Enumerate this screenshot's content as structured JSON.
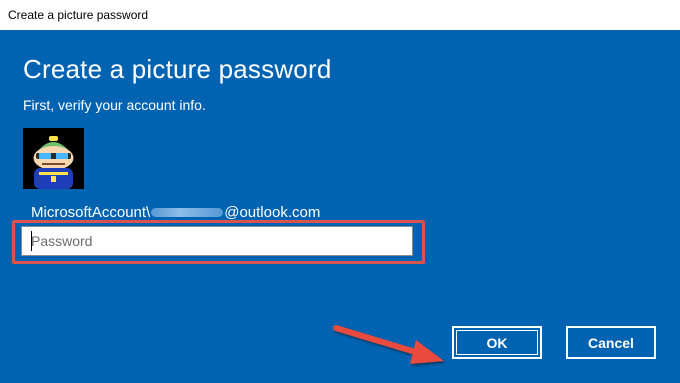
{
  "window": {
    "title": "Create a picture password"
  },
  "dialog": {
    "heading": "Create a picture password",
    "subheading": "First, verify your account info.",
    "avatar": {
      "icon": "user-avatar-icon"
    },
    "account": {
      "prefix": "MicrosoftAccount\\",
      "suffix": "@outlook.com"
    },
    "password": {
      "placeholder": "Password",
      "value": ""
    }
  },
  "buttons": {
    "ok_label": "OK",
    "cancel_label": "Cancel"
  },
  "annotation": {
    "highlight_color": "#d9534f",
    "arrow_color": "#e84c3d"
  },
  "colors": {
    "background": "#0063b1",
    "text": "#ffffff"
  }
}
